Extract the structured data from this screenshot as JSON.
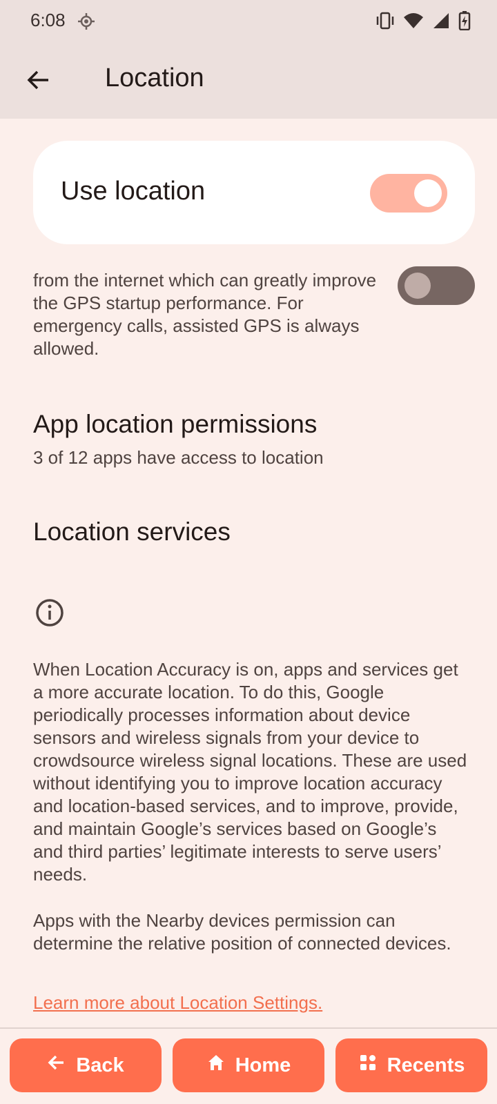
{
  "status_bar": {
    "time": "6:08",
    "icons": [
      "location-icon",
      "vibrate-icon",
      "wifi-icon",
      "signal-icon",
      "battery-charging-icon"
    ]
  },
  "app_bar": {
    "back_icon": "arrow-back-icon",
    "title": "Location"
  },
  "use_location": {
    "label": "Use location",
    "enabled": true
  },
  "assisted_gps": {
    "text": "from the internet which can greatly improve the GPS startup performance. For emergency calls, assisted GPS is always allowed.",
    "enabled": false
  },
  "app_permissions": {
    "title": "App location permissions",
    "subtitle": "3 of 12 apps have access to location"
  },
  "location_services": {
    "title": "Location services"
  },
  "info": {
    "icon": "info-icon",
    "paragraph1": "When Location Accuracy is on, apps and services get a more accurate location. To do this, Google periodically processes information about device sensors and wireless signals from your device to crowdsource wireless signal locations. These are used without identifying you to improve location accuracy and location-based services, and to improve, provide, and maintain Google’s services based on Google’s and third parties’ legitimate interests to serve users’ needs.",
    "paragraph2": "Apps with the Nearby devices permission can determine the relative position of connected devices.",
    "link": "Learn more about Location Settings."
  },
  "nav": {
    "back_label": "Back",
    "home_label": "Home",
    "recents_label": "Recents"
  },
  "colors": {
    "accent": "#ff6e4d",
    "link": "#f26f4e",
    "switch_on_track": "#ffb4a1",
    "switch_off_track": "#776662",
    "background": "#fcefeb"
  }
}
